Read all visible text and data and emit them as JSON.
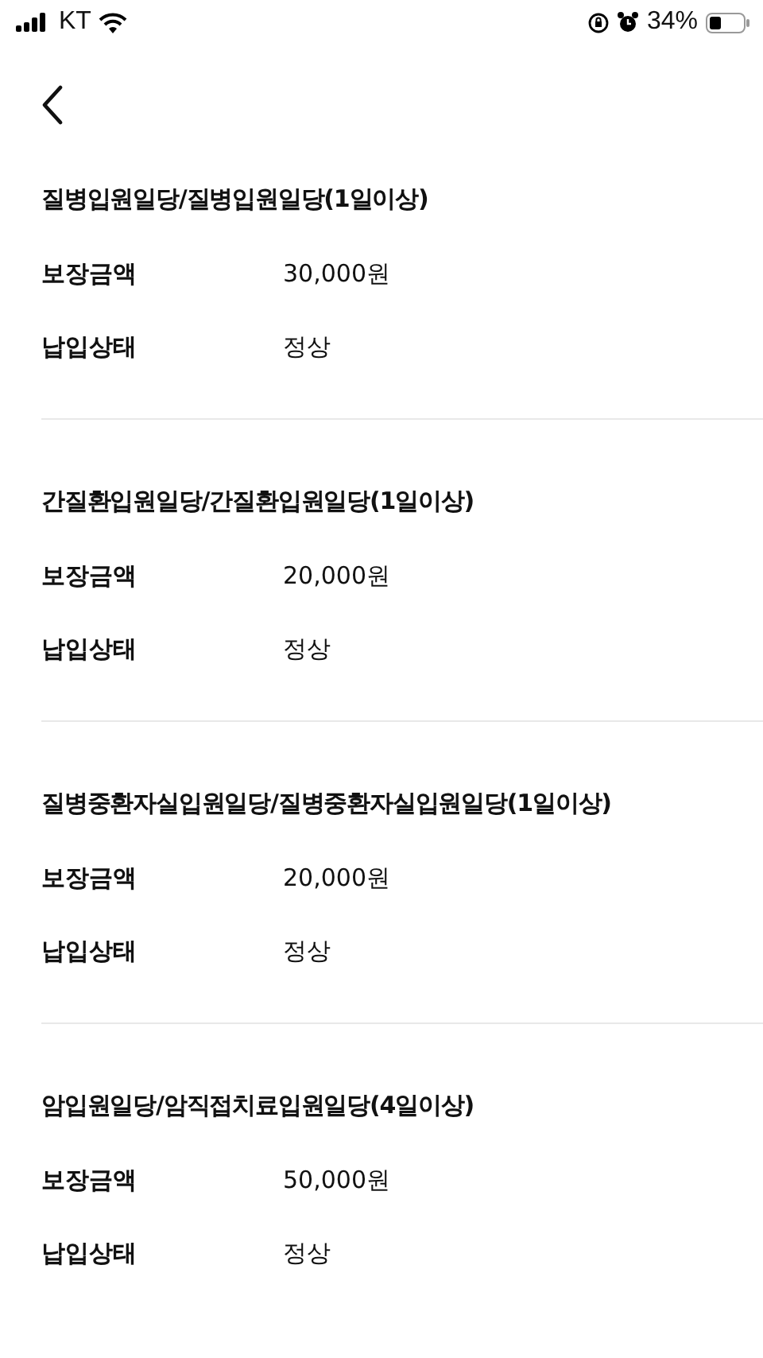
{
  "status_bar": {
    "carrier": "KT",
    "battery": "34%"
  },
  "sections": [
    {
      "title": "질병입원일당/질병입원일당(1일이상)",
      "rows": [
        {
          "label": "보장금액",
          "value": "30,000원"
        },
        {
          "label": "납입상태",
          "value": "정상"
        }
      ]
    },
    {
      "title": "간질환입원일당/간질환입원일당(1일이상)",
      "rows": [
        {
          "label": "보장금액",
          "value": "20,000원"
        },
        {
          "label": "납입상태",
          "value": "정상"
        }
      ]
    },
    {
      "title": "질병중환자실입원일당/질병중환자실입원일당(1일이상)",
      "rows": [
        {
          "label": "보장금액",
          "value": "20,000원"
        },
        {
          "label": "납입상태",
          "value": "정상"
        }
      ]
    },
    {
      "title": "암입원일당/암직접치료입원일당(4일이상)",
      "rows": [
        {
          "label": "보장금액",
          "value": "50,000원"
        },
        {
          "label": "납입상태",
          "value": "정상"
        }
      ]
    }
  ]
}
